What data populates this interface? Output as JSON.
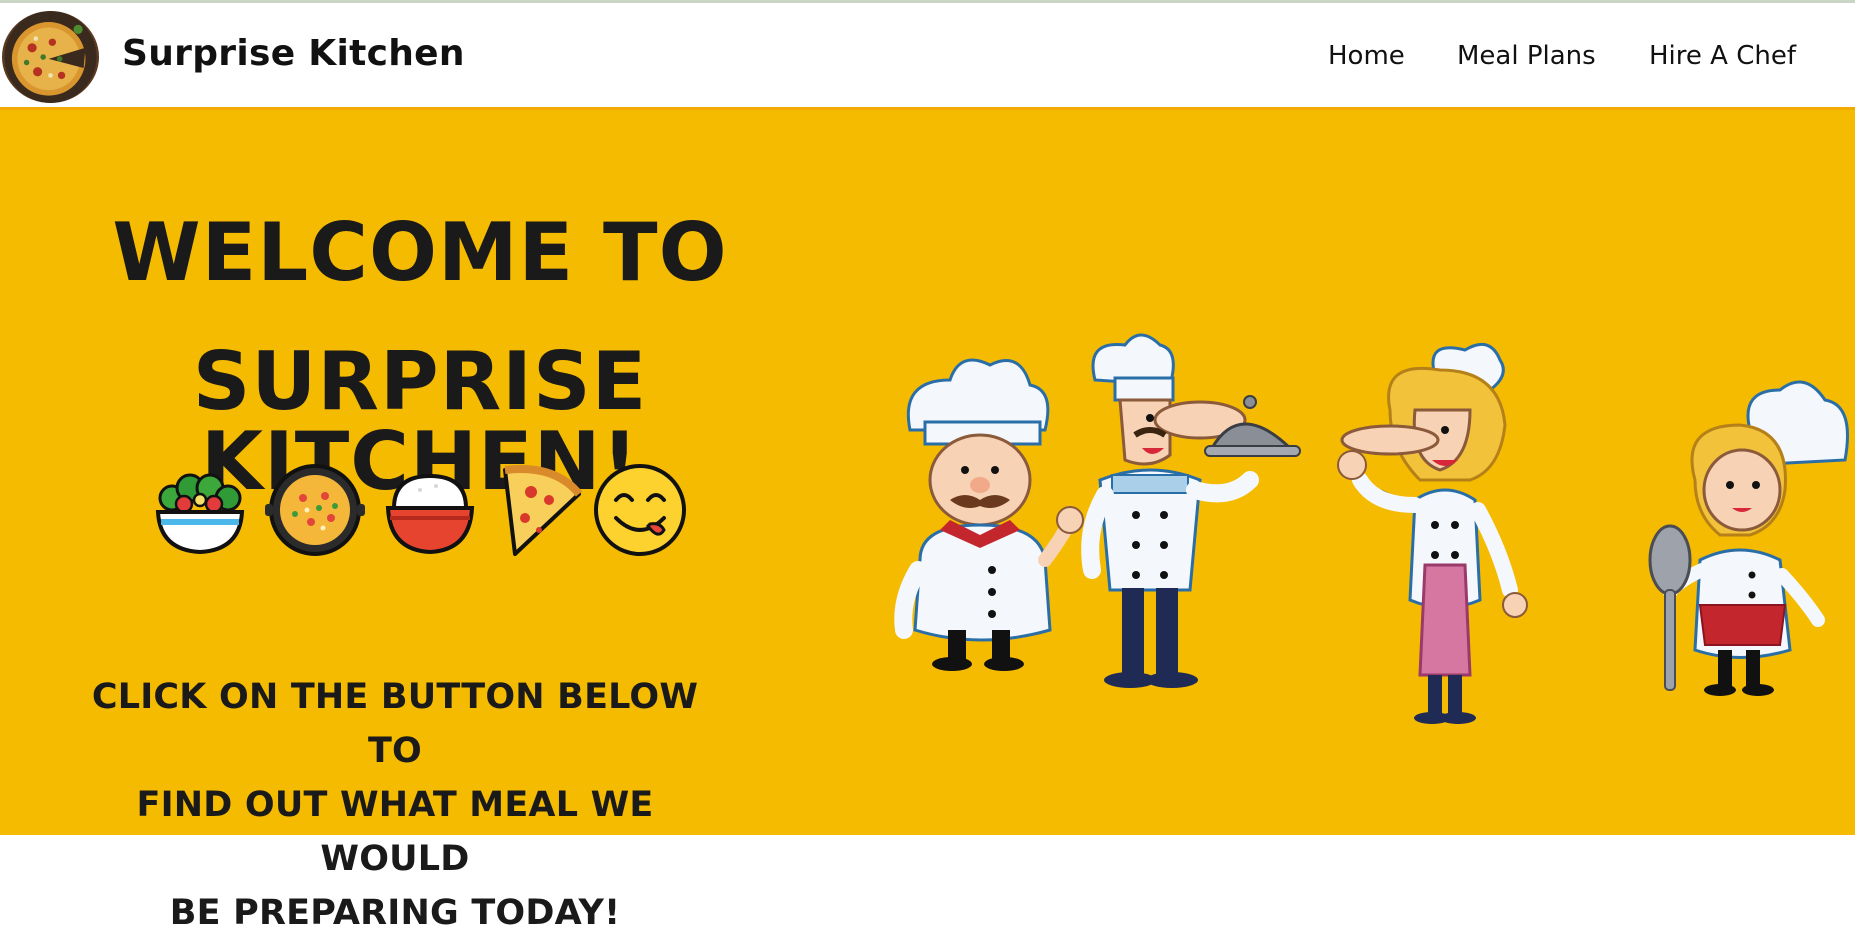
{
  "navbar": {
    "brand_name": "Surprise Kitchen",
    "logo_icon": "pizza-icon",
    "links": [
      {
        "label": "Home"
      },
      {
        "label": "Meal Plans"
      },
      {
        "label": "Hire A Chef"
      }
    ]
  },
  "hero": {
    "title_line1": "WELCOME TO",
    "title_line2": "SURPRISE KITCHEN!",
    "emojis": [
      "salad-icon",
      "paella-icon",
      "rice-bowl-icon",
      "pizza-slice-icon",
      "yum-face-icon"
    ],
    "cta_line1": "CLICK ON THE BUTTON BELOW TO",
    "cta_line2": "FIND OUT WHAT MEAL WE WOULD",
    "cta_line3": "BE PREPARING TODAY!",
    "illustration": "cartoon-chefs-illustration",
    "background_color": "#f5bb00"
  }
}
